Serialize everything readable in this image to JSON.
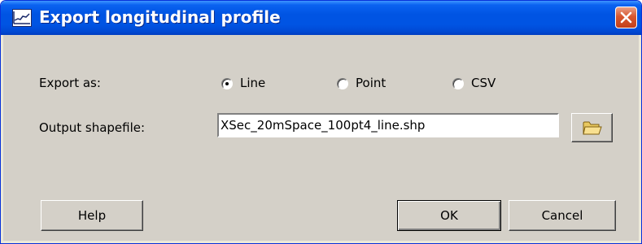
{
  "window": {
    "title": "Export longitudinal profile",
    "title_icon": "profile-chart-icon",
    "close_icon": "close-icon"
  },
  "export_as": {
    "label": "Export as:",
    "options": [
      {
        "label": "Line",
        "selected": true
      },
      {
        "label": "Point",
        "selected": false
      },
      {
        "label": "CSV",
        "selected": false
      }
    ]
  },
  "output": {
    "label": "Output shapefile:",
    "value": "XSec_20mSpace_100pt4_line.shp",
    "browse_icon": "folder-icon"
  },
  "buttons": {
    "help": "Help",
    "ok": "OK",
    "cancel": "Cancel"
  },
  "colors": {
    "titlebar": "#0054e3",
    "close_button": "#d8572f",
    "dialog_face": "#d4d0c8"
  }
}
